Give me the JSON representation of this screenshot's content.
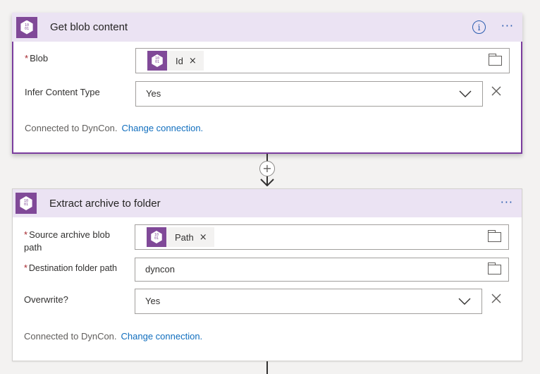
{
  "card1": {
    "title": "Get blob content",
    "info_icon": "i",
    "more_icon": "···",
    "icon_text": "10\n01",
    "blob": {
      "label": "Blob",
      "required": "*",
      "token": "Id",
      "token_remove": "×"
    },
    "infer": {
      "label": "Infer Content Type",
      "value": "Yes"
    },
    "connected_text": "Connected to DynCon.",
    "change_link": "Change connection."
  },
  "connector": {
    "add_symbol": "+"
  },
  "card2": {
    "title": "Extract archive to folder",
    "more_icon": "···",
    "icon_text": "10\n01",
    "source": {
      "label": "Source archive blob path",
      "required": "*",
      "token": "Path",
      "token_remove": "×"
    },
    "destination": {
      "label": "Destination folder path",
      "required": "*",
      "value": "dyncon"
    },
    "overwrite": {
      "label": "Overwrite?",
      "value": "Yes"
    },
    "connected_text": "Connected to DynCon.",
    "change_link": "Change connection."
  },
  "colors": {
    "accent_purple": "#804998",
    "header_bg": "#ebe3f3",
    "link_blue": "#106ebe",
    "required_red": "#a4262c"
  }
}
